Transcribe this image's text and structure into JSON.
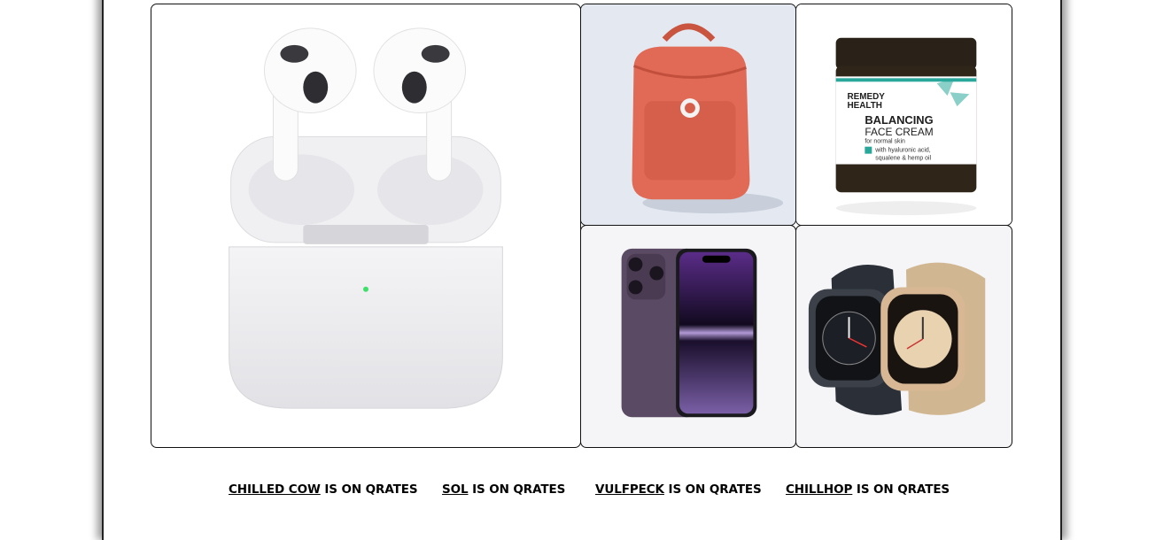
{
  "products": [
    {
      "id": "airpods",
      "icon": "airpods-image",
      "bg": "#ffffff"
    },
    {
      "id": "backpack",
      "icon": "backpack-image",
      "bg": "#e4e9f1"
    },
    {
      "id": "face-cream",
      "icon": "face-cream-image",
      "bg": "#ffffff",
      "label": {
        "brand_line1": "REMEDY",
        "brand_line2": "HEALTH",
        "name_line1": "BALANCING",
        "name_line2": "FACE CREAM",
        "sub": "for normal skin",
        "note_line1": "with hyaluronic acid,",
        "note_line2": "squalene & hemp oil"
      }
    },
    {
      "id": "iphone",
      "icon": "iphone-image",
      "bg": "#f5f5f7"
    },
    {
      "id": "watch",
      "icon": "watch-image",
      "bg": "#f5f5f7"
    }
  ],
  "links": [
    {
      "name": "CHILLED COW",
      "suffix": " IS ON QRATES"
    },
    {
      "name": "SOL",
      "suffix": " IS ON QRATES"
    },
    {
      "name": "VULFPECK",
      "suffix": " IS ON QRATES"
    },
    {
      "name": "CHILLHOP",
      "suffix": " IS ON QRATES"
    }
  ],
  "colors": {
    "backpack": "#e06a55",
    "cream_accent": "#2aa79b",
    "phone": "#5b4a63",
    "watch_gold": "#d8b894"
  }
}
